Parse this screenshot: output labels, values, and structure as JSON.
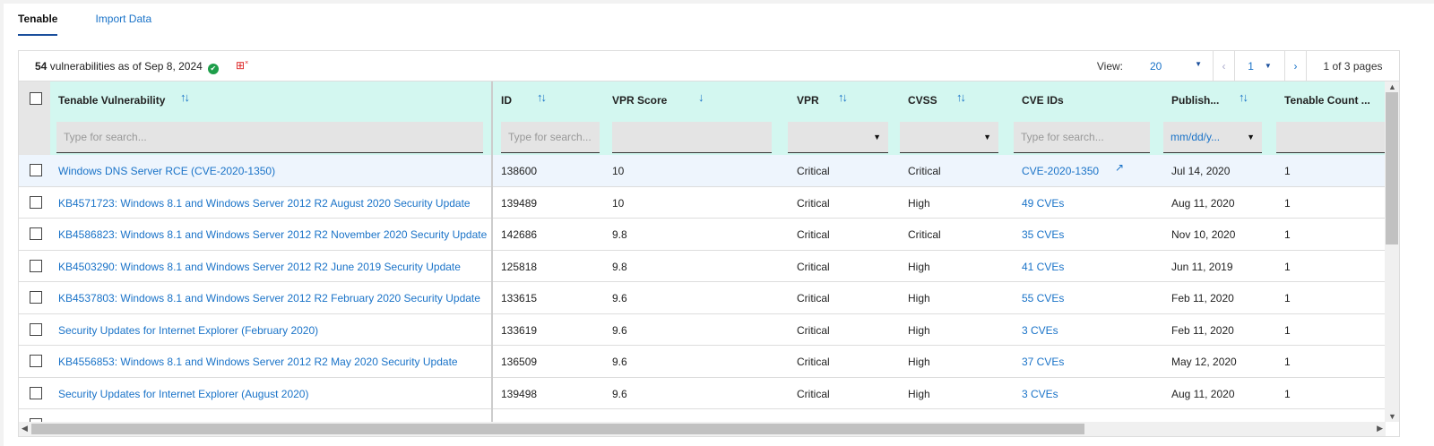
{
  "tabs": [
    {
      "label": "Tenable"
    },
    {
      "label": "Import Data"
    }
  ],
  "toolbar": {
    "count": "54",
    "count_text": "vulnerabilities as of Sep 8, 2024",
    "view_label": "View:",
    "view_value": "20",
    "page_value": "1",
    "page_info": "1 of 3 pages"
  },
  "columns": [
    {
      "title": "Tenable Vulnerability",
      "filter": "Type for search..."
    },
    {
      "title": "ID",
      "filter": "Type for search..."
    },
    {
      "title": "VPR Score",
      "filter": ""
    },
    {
      "title": "VPR",
      "filter": ""
    },
    {
      "title": "CVSS",
      "filter": ""
    },
    {
      "title": "CVE IDs",
      "filter": "Type for search..."
    },
    {
      "title": "Publish...",
      "filter": "mm/dd/y..."
    },
    {
      "title": "Tenable Count ...",
      "filter": ""
    }
  ],
  "rows": [
    {
      "name": "Windows DNS Server RCE (CVE-2020-1350)",
      "id": "138600",
      "vpr_score": "10",
      "vpr": "Critical",
      "cvss": "Critical",
      "cve": "CVE-2020-1350",
      "published": "Jul 14, 2020",
      "count": "1"
    },
    {
      "name": "KB4571723: Windows 8.1 and Windows Server 2012 R2 August 2020 Security Update",
      "id": "139489",
      "vpr_score": "10",
      "vpr": "Critical",
      "cvss": "High",
      "cve": "49 CVEs",
      "published": "Aug 11, 2020",
      "count": "1"
    },
    {
      "name": "KB4586823: Windows 8.1 and Windows Server 2012 R2 November 2020 Security Update",
      "id": "142686",
      "vpr_score": "9.8",
      "vpr": "Critical",
      "cvss": "Critical",
      "cve": "35 CVEs",
      "published": "Nov 10, 2020",
      "count": "1"
    },
    {
      "name": "KB4503290: Windows 8.1 and Windows Server 2012 R2 June 2019 Security Update",
      "id": "125818",
      "vpr_score": "9.8",
      "vpr": "Critical",
      "cvss": "High",
      "cve": "41 CVEs",
      "published": "Jun 11, 2019",
      "count": "1"
    },
    {
      "name": "KB4537803: Windows 8.1 and Windows Server 2012 R2 February 2020 Security Update",
      "id": "133615",
      "vpr_score": "9.6",
      "vpr": "Critical",
      "cvss": "High",
      "cve": "55 CVEs",
      "published": "Feb 11, 2020",
      "count": "1"
    },
    {
      "name": "Security Updates for Internet Explorer (February 2020)",
      "id": "133619",
      "vpr_score": "9.6",
      "vpr": "Critical",
      "cvss": "High",
      "cve": "3 CVEs",
      "published": "Feb 11, 2020",
      "count": "1"
    },
    {
      "name": "KB4556853: Windows 8.1 and Windows Server 2012 R2 May 2020 Security Update",
      "id": "136509",
      "vpr_score": "9.6",
      "vpr": "Critical",
      "cvss": "High",
      "cve": "37 CVEs",
      "published": "May 12, 2020",
      "count": "1"
    },
    {
      "name": "Security Updates for Internet Explorer (August 2020)",
      "id": "139498",
      "vpr_score": "9.6",
      "vpr": "Critical",
      "cvss": "High",
      "cve": "3 CVEs",
      "published": "Aug 11, 2020",
      "count": "1"
    }
  ]
}
